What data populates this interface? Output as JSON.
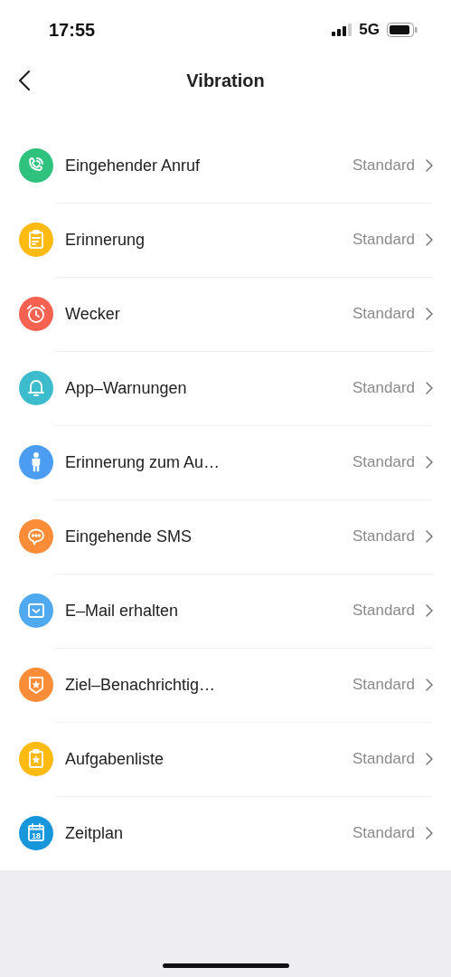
{
  "status_bar": {
    "time": "17:55",
    "network": "5G"
  },
  "nav": {
    "title": "Vibration"
  },
  "items": [
    {
      "label": "Eingehender Anruf",
      "value": "Standard",
      "kind": "phone",
      "color": "#2ec27e"
    },
    {
      "label": "Erinnerung",
      "value": "Standard",
      "kind": "notes",
      "color": "#fdbb12"
    },
    {
      "label": "Wecker",
      "value": "Standard",
      "kind": "alarm",
      "color": "#f5624f"
    },
    {
      "label": "App–Warnungen",
      "value": "Standard",
      "kind": "bell",
      "color": "#3cbccd"
    },
    {
      "label": "Erinnerung zum Au…",
      "value": "Standard",
      "kind": "person",
      "color": "#4a9df2"
    },
    {
      "label": "Eingehende SMS",
      "value": "Standard",
      "kind": "chat",
      "color": "#fb8d38"
    },
    {
      "label": "E–Mail erhalten",
      "value": "Standard",
      "kind": "mail",
      "color": "#4fa9ef"
    },
    {
      "label": "Ziel–Benachrichtig…",
      "value": "Standard",
      "kind": "banner",
      "color": "#fb8d38"
    },
    {
      "label": "Aufgabenliste",
      "value": "Standard",
      "kind": "clipboard",
      "color": "#fdbb12"
    },
    {
      "label": "Zeitplan",
      "value": "Standard",
      "kind": "calendar",
      "color": "#1796db",
      "icon_text": "18"
    }
  ]
}
